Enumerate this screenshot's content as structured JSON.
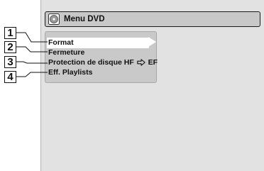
{
  "menu": {
    "title": "Menu DVD",
    "items": [
      {
        "label": "Format",
        "selected": true,
        "callout": "1"
      },
      {
        "label": "Fermeture",
        "selected": false,
        "callout": "2"
      },
      {
        "label_before": "Protection de disque HF",
        "label_after": "EF",
        "callout": "3"
      },
      {
        "label": "Eff. Playlists",
        "selected": false,
        "callout": "4"
      }
    ]
  },
  "colors": {
    "screen": "#e2e2e2",
    "panel": "#c9c9c9",
    "highlight": "#ffffff",
    "text": "#111111"
  },
  "icons": {
    "title": "dvd-disc-icon",
    "selector": "triangle-right-icon",
    "inline": "hollow-arrow-right-icon"
  }
}
